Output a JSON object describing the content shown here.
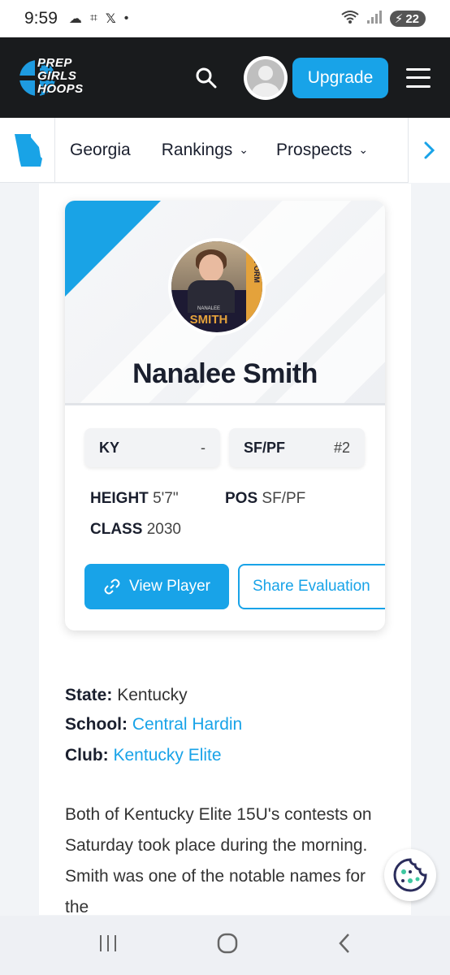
{
  "status_bar": {
    "time": "9:59",
    "battery": "22"
  },
  "header": {
    "logo_lines": [
      "PREP",
      "GIRLS",
      "HOOPS"
    ],
    "upgrade_label": "Upgrade"
  },
  "nav": {
    "items": [
      {
        "label": "Georgia"
      },
      {
        "label": "Rankings"
      },
      {
        "label": "Prospects"
      }
    ]
  },
  "player_card": {
    "photo_caption_small": "NANALEE",
    "photo_caption_big": "SMITH",
    "photo_vertical": "PERFORM",
    "name": "Nanalee Smith",
    "pill_state": "KY",
    "pill_state_value": "-",
    "pill_pos": "SF/PF",
    "pill_rank": "#2",
    "height_label": "HEIGHT",
    "height_value": "5'7\"",
    "pos_label": "POS",
    "pos_value": "SF/PF",
    "class_label": "CLASS",
    "class_value": "2030",
    "view_button": "View Player",
    "share_button": "Share Evaluation"
  },
  "details": {
    "state_label": "State:",
    "state_value": "Kentucky",
    "school_label": "School:",
    "school_value": "Central Hardin",
    "club_label": "Club:",
    "club_value": "Kentucky Elite"
  },
  "article": {
    "text": "Both of Kentucky Elite 15U's contests on Saturday took place during the morning. Smith was one of the notable names for the"
  },
  "colors": {
    "accent": "#18a3e8",
    "header_bg": "#191b1d",
    "text": "#1a1f2e"
  }
}
